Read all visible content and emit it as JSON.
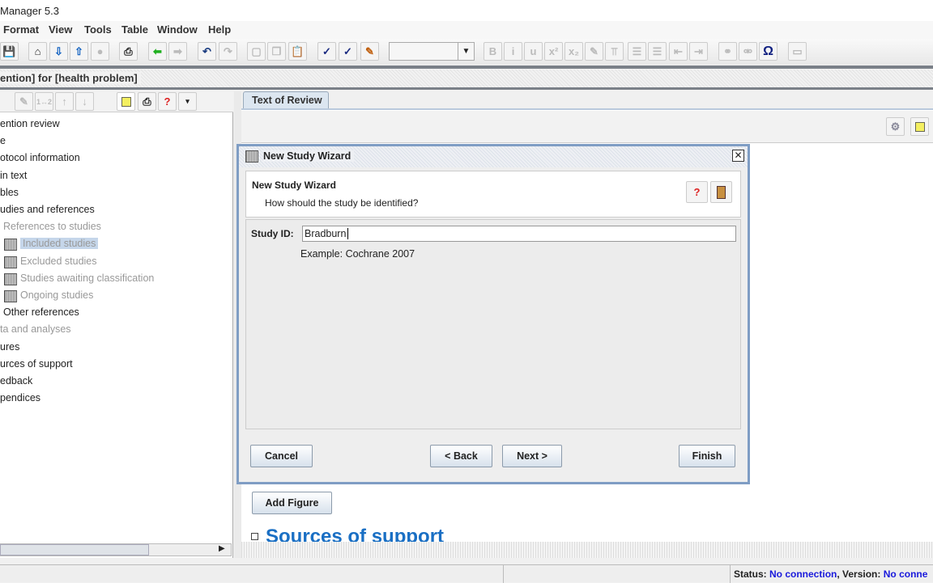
{
  "window": {
    "title": "Manager 5.3"
  },
  "menu": [
    {
      "label": "Format"
    },
    {
      "label": "View"
    },
    {
      "label": "Tools"
    },
    {
      "label": "Table"
    },
    {
      "label": "Window"
    },
    {
      "label": "Help"
    }
  ],
  "toolbar": {
    "icons": [
      "save-icon",
      "home-icon",
      "import-icon",
      "export-icon",
      "disabled-icon",
      "print-icon",
      "back-arrow-icon",
      "forward-arrow-icon",
      "undo-icon",
      "redo-icon",
      "cut-icon",
      "copy-icon",
      "paste-icon",
      "validate-icon",
      "spellcheck-icon",
      "notes-icon"
    ],
    "format_icons": [
      "bold-icon",
      "italic-icon",
      "underline-icon",
      "superscript-icon",
      "subscript-icon",
      "highlight-icon",
      "text-color-icon",
      "bullet-list-icon",
      "numbered-list-icon",
      "outdent-icon",
      "indent-icon",
      "link-icon",
      "unlink-icon",
      "special-character-icon",
      "table-icon"
    ],
    "style_combo": ""
  },
  "review_title": "ention] for [health problem]",
  "tree": {
    "items": [
      {
        "label": "ention review",
        "state": "normal"
      },
      {
        "label": "e",
        "state": "normal"
      },
      {
        "label": "otocol information",
        "state": "normal"
      },
      {
        "label": "in text",
        "state": "normal"
      },
      {
        "label": "bles",
        "state": "normal"
      },
      {
        "label": "udies and references",
        "state": "normal"
      },
      {
        "label": "References to studies",
        "state": "gray"
      },
      {
        "label": "Included studies",
        "state": "selected"
      },
      {
        "label": "Excluded studies",
        "state": "gray"
      },
      {
        "label": "Studies awaiting classification",
        "state": "gray"
      },
      {
        "label": "Ongoing studies",
        "state": "gray"
      },
      {
        "label": "Other references",
        "state": "normal"
      },
      {
        "label": "ta and analyses",
        "state": "gray"
      },
      {
        "label": "ures",
        "state": "normal"
      },
      {
        "label": "urces of support",
        "state": "normal"
      },
      {
        "label": "edback",
        "state": "normal"
      },
      {
        "label": "pendices",
        "state": "normal"
      }
    ]
  },
  "tab": {
    "label": "Text of Review"
  },
  "dialog": {
    "title": "New Study Wizard",
    "heading": "New Study Wizard",
    "subheading": "How should the study be identified?",
    "field_label": "Study ID:",
    "field_value": "Bradburn",
    "example": "Example: Cochrane 2007",
    "cancel": "Cancel",
    "back": "< Back",
    "next": "Next >",
    "finish": "Finish"
  },
  "content": {
    "add_figure": "Add Figure",
    "section_heading": "Sources of support"
  },
  "status": {
    "status_label": "Status:",
    "status_value": "No connection",
    "version_label": "Version:",
    "version_value": "No conne"
  },
  "colors": {
    "selection": "#c5d6ea",
    "heading": "#1a6fc4",
    "status_value": "#1a1adc"
  }
}
